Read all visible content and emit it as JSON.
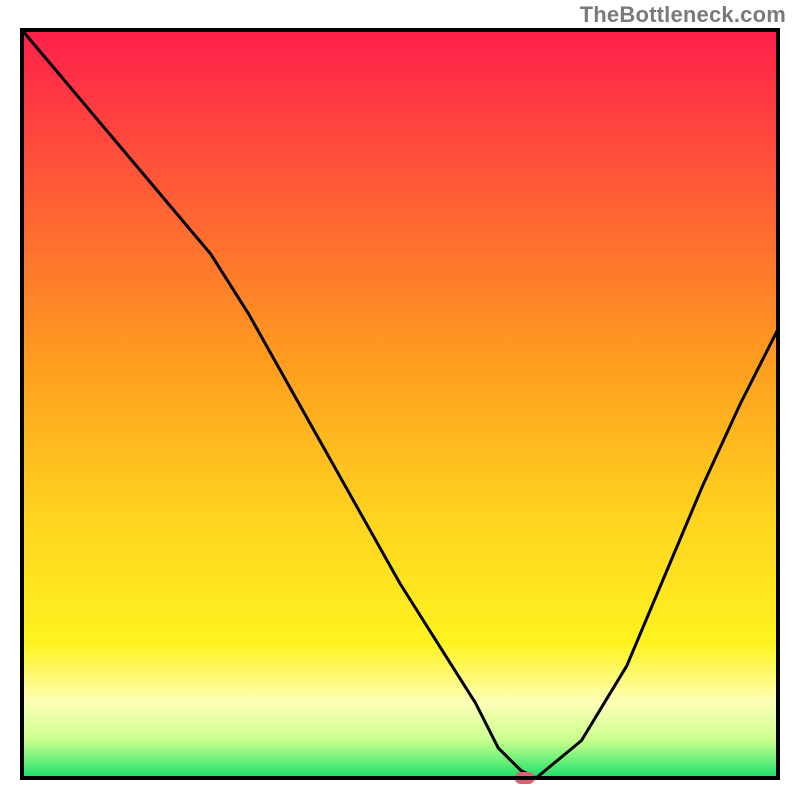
{
  "watermark": "TheBottleneck.com",
  "chart_data": {
    "type": "line",
    "title": "",
    "xlabel": "",
    "ylabel": "",
    "xlim": [
      0,
      100
    ],
    "ylim": [
      0,
      100
    ],
    "x": [
      0,
      5,
      10,
      15,
      20,
      25,
      30,
      35,
      40,
      45,
      50,
      55,
      60,
      63,
      66,
      68,
      74,
      80,
      85,
      90,
      95,
      100
    ],
    "values": [
      100,
      94,
      88,
      82,
      76,
      70,
      62,
      53,
      44,
      35,
      26,
      18,
      10,
      4,
      1,
      0,
      5,
      15,
      27,
      39,
      50,
      60
    ],
    "gradient_stops": [
      {
        "pct": 0,
        "color": "#ff1f4b"
      },
      {
        "pct": 45,
        "color": "#ff9e1f"
      },
      {
        "pct": 65,
        "color": "#ffd31f"
      },
      {
        "pct": 82,
        "color": "#fff31f"
      },
      {
        "pct": 90,
        "color": "#fdffb8"
      },
      {
        "pct": 95,
        "color": "#c8ff8c"
      },
      {
        "pct": 100,
        "color": "#18e06a"
      }
    ],
    "marker": {
      "x": 66.5,
      "y": 0,
      "color": "#d6636d",
      "rx": 10,
      "ry": 6
    },
    "frame": {
      "stroke": "#000000",
      "width": 4
    }
  }
}
